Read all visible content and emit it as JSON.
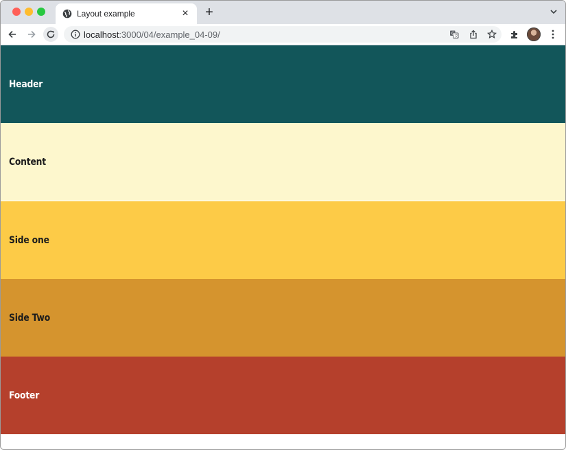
{
  "browser": {
    "tab": {
      "title": "Layout example",
      "close_glyph": "×",
      "favicon": "globe-icon"
    },
    "new_tab_glyph": "+",
    "address": {
      "host": "localhost",
      "path": ":3000/04/example_04-09/"
    },
    "toolbar_icons": [
      "back-icon",
      "forward-icon",
      "reload-icon",
      "info-icon",
      "translate-icon",
      "share-icon",
      "star-icon",
      "extensions-icon",
      "avatar",
      "menu-icon"
    ]
  },
  "page": {
    "sections": [
      {
        "label": "Header",
        "color": "#12565a"
      },
      {
        "label": "Content",
        "color": "#fdf7cd"
      },
      {
        "label": "Side one",
        "color": "#fdcb47"
      },
      {
        "label": "Side Two",
        "color": "#d5942e"
      },
      {
        "label": "Footer",
        "color": "#b5402c"
      }
    ]
  }
}
